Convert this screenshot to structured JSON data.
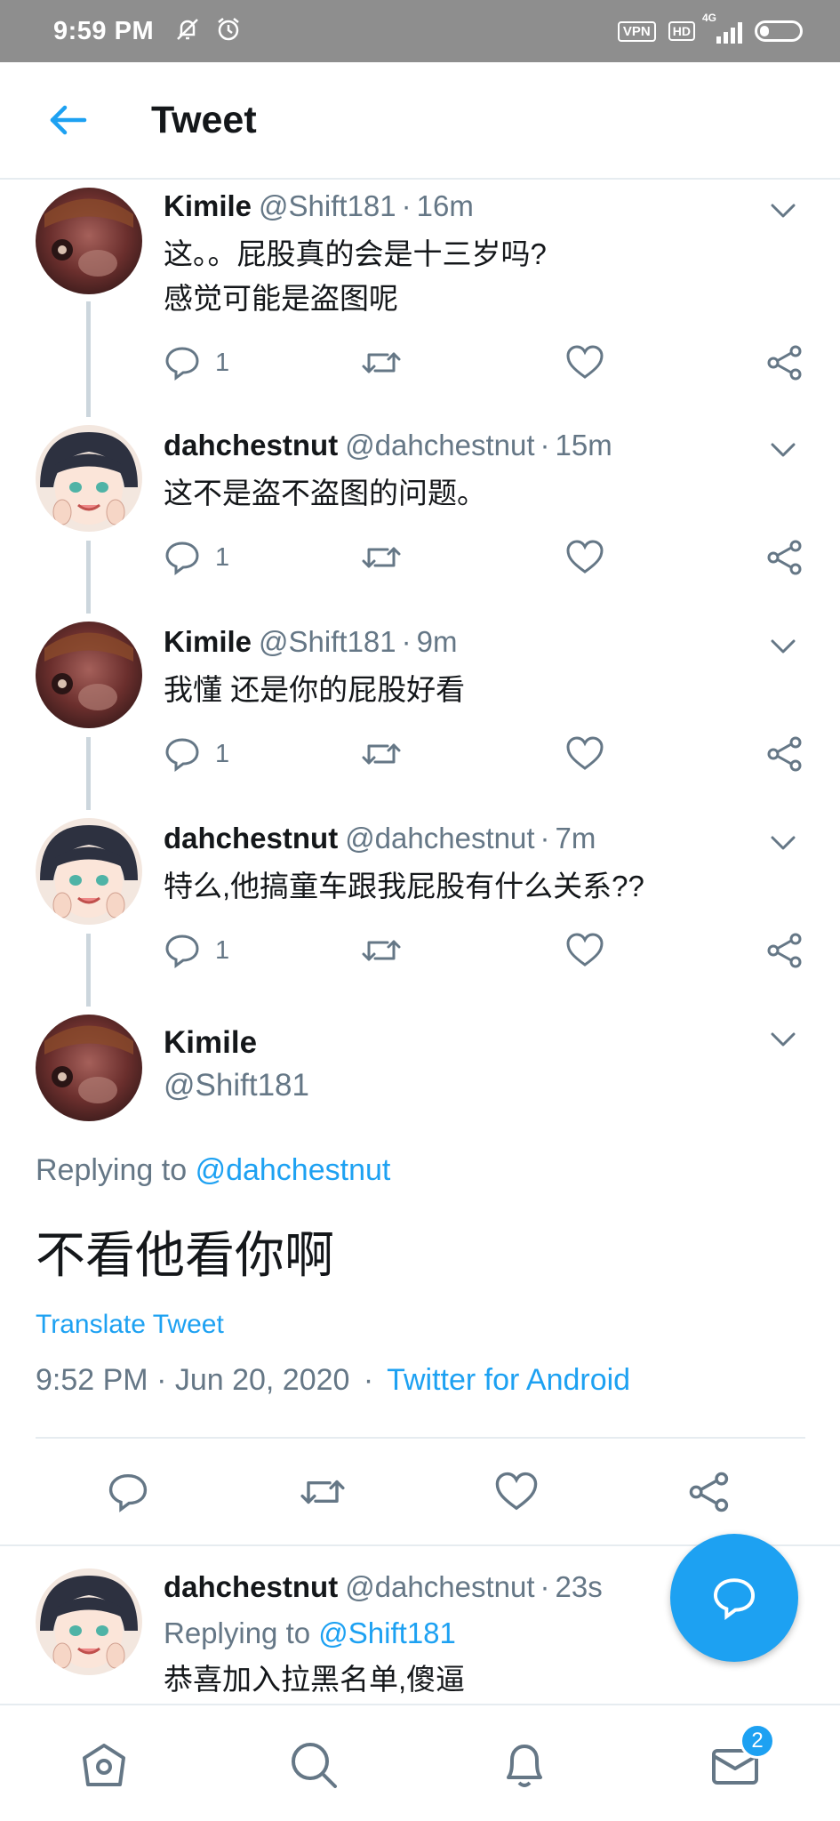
{
  "status_bar": {
    "time": "9:59 PM",
    "icons": [
      "mute-icon",
      "alarm-icon"
    ],
    "vpn": "VPN",
    "hd": "HD",
    "network": "4G"
  },
  "header": {
    "title": "Tweet"
  },
  "thread": [
    {
      "name": "Kimile",
      "handle": "@Shift181",
      "time": "16m",
      "lines": [
        "这。。屁股真的会是十三岁吗?",
        "感觉可能是盗图呢"
      ],
      "reply_count": "1",
      "avatar": "kimile"
    },
    {
      "name": "dahchestnut",
      "handle": "@dahchestnut",
      "time": "15m",
      "lines": [
        "这不是盗不盗图的问题。"
      ],
      "reply_count": "1",
      "avatar": "dahchestnut"
    },
    {
      "name": "Kimile",
      "handle": "@Shift181",
      "time": "9m",
      "lines": [
        "我懂 还是你的屁股好看"
      ],
      "reply_count": "1",
      "avatar": "kimile"
    },
    {
      "name": "dahchestnut",
      "handle": "@dahchestnut",
      "time": "7m",
      "lines": [
        "特么,他搞童车跟我屁股有什么关系??"
      ],
      "reply_count": "1",
      "avatar": "dahchestnut"
    }
  ],
  "main_tweet": {
    "name": "Kimile",
    "handle": "@Shift181",
    "replying_prefix": "Replying to",
    "replying_to": "@dahchestnut",
    "text": "不看他看你啊",
    "translate": "Translate Tweet",
    "timestamp": "9:52 PM · Jun 20, 2020",
    "meta_sep": "·",
    "source": "Twitter for Android"
  },
  "reply": {
    "name": "dahchestnut",
    "handle": "@dahchestnut",
    "time": "23s",
    "replying_prefix": "Replying to",
    "replying_to": "@Shift181",
    "text": "恭喜加入拉黑名单,傻逼"
  },
  "bottom_nav": {
    "notifications_badge": "2"
  },
  "colors": {
    "accent": "#1da1f2",
    "secondary_text": "#657786",
    "divider": "#e6ecf0"
  }
}
